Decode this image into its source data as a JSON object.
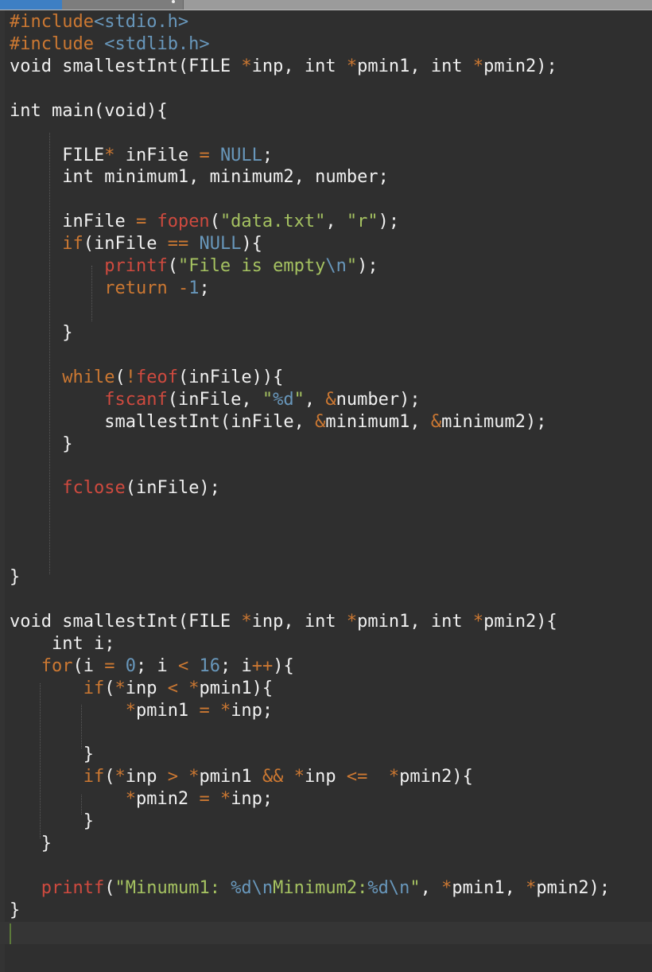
{
  "editor": {
    "tab_label": "",
    "lines": [
      [
        [
          "k",
          "#include"
        ],
        [
          "n",
          "<stdio.h>"
        ]
      ],
      [
        [
          "k",
          "#include "
        ],
        [
          "n",
          "<stdlib.h>"
        ]
      ],
      [
        [
          "p",
          "void smallestInt(FILE "
        ],
        [
          "k",
          "*"
        ],
        [
          "p",
          "inp, int "
        ],
        [
          "k",
          "*"
        ],
        [
          "p",
          "pmin1, int "
        ],
        [
          "k",
          "*"
        ],
        [
          "p",
          "pmin2);"
        ]
      ],
      [],
      [
        [
          "p",
          "int main(void){"
        ]
      ],
      [],
      [
        [
          "p",
          "     FILE"
        ],
        [
          "k",
          "*"
        ],
        [
          "p",
          " inFile "
        ],
        [
          "k",
          "="
        ],
        [
          "p",
          " "
        ],
        [
          "n",
          "NULL"
        ],
        [
          "p",
          ";"
        ]
      ],
      [
        [
          "p",
          "     int minimum1, minimum2, number;"
        ]
      ],
      [],
      [
        [
          "p",
          "     inFile "
        ],
        [
          "k",
          "="
        ],
        [
          "p",
          " "
        ],
        [
          "f",
          "fopen"
        ],
        [
          "p",
          "("
        ],
        [
          "s",
          "\"data.txt\""
        ],
        [
          "p",
          ", "
        ],
        [
          "s",
          "\"r\""
        ],
        [
          "p",
          ");"
        ]
      ],
      [
        [
          "p",
          "     "
        ],
        [
          "k",
          "if"
        ],
        [
          "p",
          "(inFile "
        ],
        [
          "k",
          "=="
        ],
        [
          "p",
          " "
        ],
        [
          "n",
          "NULL"
        ],
        [
          "p",
          "){"
        ]
      ],
      [
        [
          "p",
          "         "
        ],
        [
          "f",
          "printf"
        ],
        [
          "p",
          "("
        ],
        [
          "s",
          "\"File is empty"
        ],
        [
          "n",
          "\\n"
        ],
        [
          "s",
          "\""
        ],
        [
          "p",
          ");"
        ]
      ],
      [
        [
          "p",
          "         "
        ],
        [
          "k",
          "return"
        ],
        [
          "p",
          " "
        ],
        [
          "k",
          "-"
        ],
        [
          "n",
          "1"
        ],
        [
          "p",
          ";"
        ]
      ],
      [],
      [
        [
          "p",
          "     }"
        ]
      ],
      [],
      [
        [
          "p",
          "     "
        ],
        [
          "k",
          "while"
        ],
        [
          "p",
          "("
        ],
        [
          "k",
          "!"
        ],
        [
          "f",
          "feof"
        ],
        [
          "p",
          "(inFile)){"
        ]
      ],
      [
        [
          "p",
          "         "
        ],
        [
          "f",
          "fscanf"
        ],
        [
          "p",
          "(inFile, "
        ],
        [
          "s",
          "\""
        ],
        [
          "n",
          "%d"
        ],
        [
          "s",
          "\""
        ],
        [
          "p",
          ", "
        ],
        [
          "k",
          "&"
        ],
        [
          "p",
          "number);"
        ]
      ],
      [
        [
          "p",
          "         smallestInt(inFile, "
        ],
        [
          "k",
          "&"
        ],
        [
          "p",
          "minimum1, "
        ],
        [
          "k",
          "&"
        ],
        [
          "p",
          "minimum2);"
        ]
      ],
      [
        [
          "p",
          "     }"
        ]
      ],
      [],
      [
        [
          "p",
          "     "
        ],
        [
          "f",
          "fclose"
        ],
        [
          "p",
          "(inFile);"
        ]
      ],
      [],
      [],
      [],
      [
        [
          "p",
          "}"
        ]
      ],
      [],
      [
        [
          "p",
          "void smallestInt(FILE "
        ],
        [
          "k",
          "*"
        ],
        [
          "p",
          "inp, int "
        ],
        [
          "k",
          "*"
        ],
        [
          "p",
          "pmin1, int "
        ],
        [
          "k",
          "*"
        ],
        [
          "p",
          "pmin2){"
        ]
      ],
      [
        [
          "p",
          "    int i;"
        ]
      ],
      [
        [
          "p",
          "   "
        ],
        [
          "k",
          "for"
        ],
        [
          "p",
          "(i "
        ],
        [
          "k",
          "="
        ],
        [
          "p",
          " "
        ],
        [
          "n",
          "0"
        ],
        [
          "p",
          "; i "
        ],
        [
          "k",
          "<"
        ],
        [
          "p",
          " "
        ],
        [
          "n",
          "16"
        ],
        [
          "p",
          "; i"
        ],
        [
          "k",
          "++"
        ],
        [
          "p",
          "){"
        ]
      ],
      [
        [
          "p",
          "       "
        ],
        [
          "k",
          "if"
        ],
        [
          "p",
          "("
        ],
        [
          "k",
          "*"
        ],
        [
          "p",
          "inp "
        ],
        [
          "k",
          "<"
        ],
        [
          "p",
          " "
        ],
        [
          "k",
          "*"
        ],
        [
          "p",
          "pmin1){"
        ]
      ],
      [
        [
          "p",
          "           "
        ],
        [
          "k",
          "*"
        ],
        [
          "p",
          "pmin1 "
        ],
        [
          "k",
          "="
        ],
        [
          "p",
          " "
        ],
        [
          "k",
          "*"
        ],
        [
          "p",
          "inp;"
        ]
      ],
      [],
      [
        [
          "p",
          "       }"
        ]
      ],
      [
        [
          "p",
          "       "
        ],
        [
          "k",
          "if"
        ],
        [
          "p",
          "("
        ],
        [
          "k",
          "*"
        ],
        [
          "p",
          "inp "
        ],
        [
          "k",
          ">"
        ],
        [
          "p",
          " "
        ],
        [
          "k",
          "*"
        ],
        [
          "p",
          "pmin1 "
        ],
        [
          "k",
          "&&"
        ],
        [
          "p",
          " "
        ],
        [
          "k",
          "*"
        ],
        [
          "p",
          "inp "
        ],
        [
          "k",
          "<="
        ],
        [
          "p",
          "  "
        ],
        [
          "k",
          "*"
        ],
        [
          "p",
          "pmin2){"
        ]
      ],
      [
        [
          "p",
          "           "
        ],
        [
          "k",
          "*"
        ],
        [
          "p",
          "pmin2 "
        ],
        [
          "k",
          "="
        ],
        [
          "p",
          " "
        ],
        [
          "k",
          "*"
        ],
        [
          "p",
          "inp;"
        ]
      ],
      [
        [
          "p",
          "       }"
        ]
      ],
      [
        [
          "p",
          "   }"
        ]
      ],
      [],
      [
        [
          "p",
          "   "
        ],
        [
          "f",
          "printf"
        ],
        [
          "p",
          "("
        ],
        [
          "s",
          "\"Minumum1: "
        ],
        [
          "n",
          "%d\\n"
        ],
        [
          "s",
          "Minimum2:"
        ],
        [
          "n",
          "%d\\n"
        ],
        [
          "s",
          "\""
        ],
        [
          "p",
          ", "
        ],
        [
          "k",
          "*"
        ],
        [
          "p",
          "pmin1, "
        ],
        [
          "k",
          "*"
        ],
        [
          "p",
          "pmin2);"
        ]
      ],
      [
        [
          "p",
          "}"
        ]
      ],
      []
    ]
  }
}
